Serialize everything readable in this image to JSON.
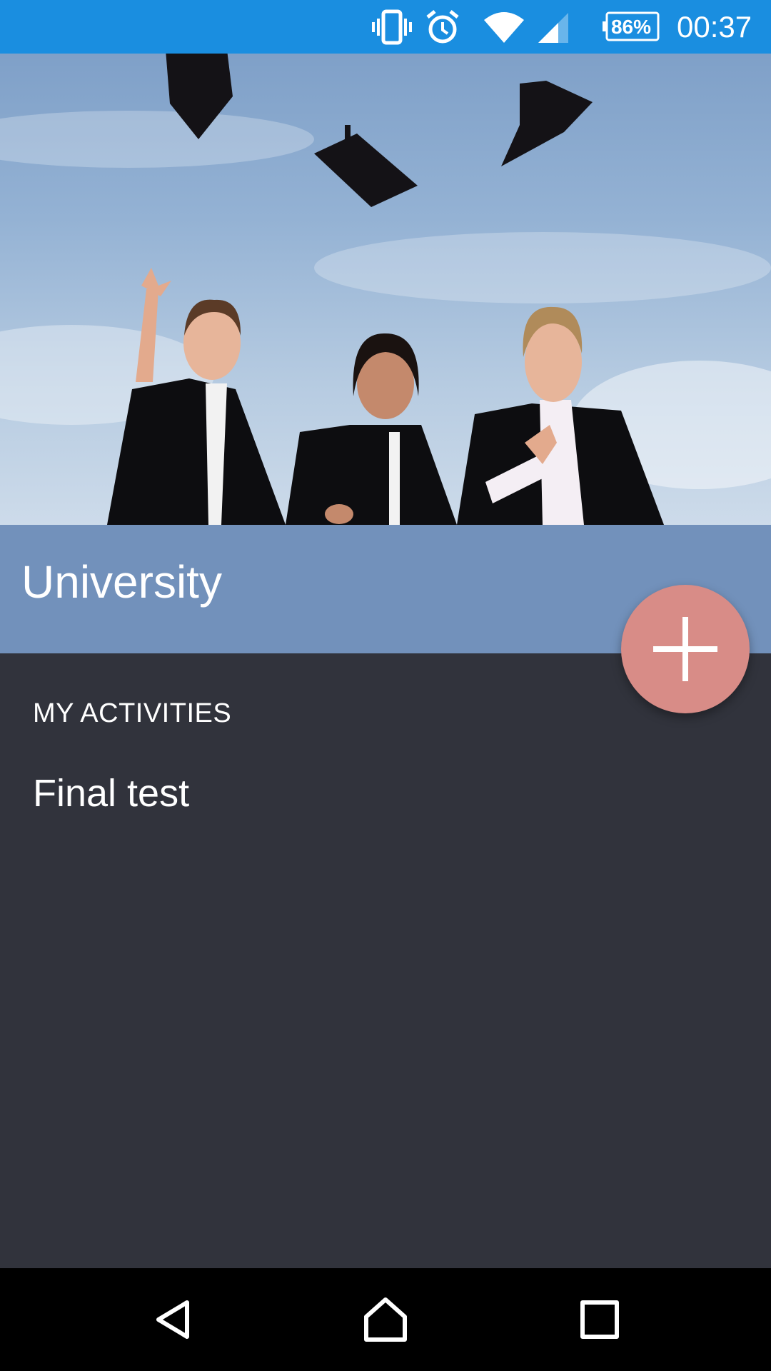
{
  "status_bar": {
    "battery_percent": "86%",
    "time": "00:37",
    "icons": [
      "vibrate-icon",
      "alarm-icon",
      "wifi-icon",
      "cell-signal-icon",
      "battery-icon"
    ]
  },
  "header": {
    "title": "University"
  },
  "fab": {
    "icon": "plus-icon"
  },
  "activities": {
    "section_label": "MY ACTIVITIES",
    "items": [
      {
        "label": "Final test"
      }
    ]
  },
  "colors": {
    "status_bar": "#1a8ee0",
    "title_band": "#7291bb",
    "background": "#31333c",
    "fab": "#d88c87",
    "nav_bar": "#000000"
  },
  "nav_bar": {
    "icons": [
      "back-icon",
      "home-icon",
      "recents-icon"
    ]
  }
}
